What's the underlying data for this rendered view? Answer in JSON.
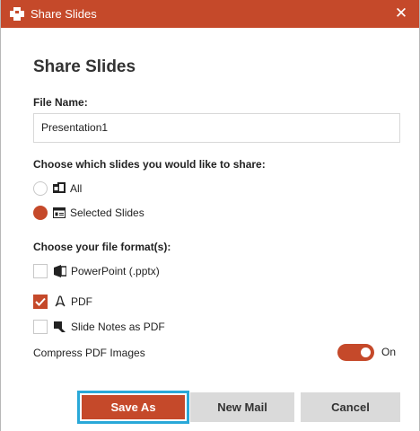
{
  "window": {
    "title": "Share Slides",
    "close_glyph": "✕",
    "app_icon": "powerpoint-share-icon"
  },
  "dialog": {
    "heading": "Share Slides",
    "file_name_label": "File Name:",
    "file_name_value": "Presentation1",
    "slides_prompt": "Choose which slides you would like to share:",
    "slide_options": [
      {
        "label": "All",
        "icon": "all-slides-icon",
        "selected": false
      },
      {
        "label": "Selected Slides",
        "icon": "selected-slides-icon",
        "selected": true
      }
    ],
    "format_prompt": "Choose your file format(s):",
    "formats": [
      {
        "label": "PowerPoint (.pptx)",
        "icon": "powerpoint-icon",
        "checked": false
      },
      {
        "label": "PDF",
        "icon": "pdf-icon",
        "checked": true
      },
      {
        "label": "Slide Notes as PDF",
        "icon": "slide-notes-icon",
        "checked": false
      }
    ],
    "compress_label": "Compress PDF Images",
    "compress_state": "On"
  },
  "buttons": {
    "save_as": "Save As",
    "new_mail": "New Mail",
    "cancel": "Cancel"
  },
  "colors": {
    "accent": "#c5492a",
    "focus_ring": "#29a8d8",
    "secondary_button": "#dadada"
  }
}
